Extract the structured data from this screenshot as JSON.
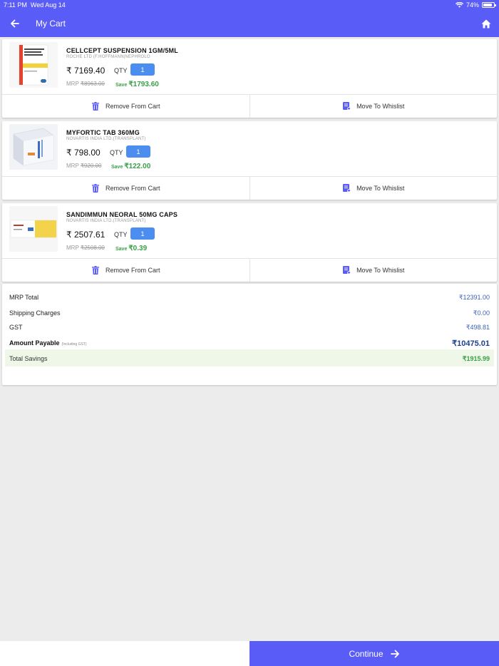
{
  "status_bar": {
    "time": "7:11 PM",
    "date": "Wed Aug 14",
    "battery": "74%"
  },
  "header": {
    "title": "My Cart",
    "back_icon": "arrow-left-icon",
    "home_icon": "home-icon"
  },
  "colors": {
    "primary": "#5a5cf8",
    "qty_button": "#4b8ef0",
    "save_green": "#3aa048",
    "price_blue": "#3b63b8"
  },
  "cart": {
    "qty_label": "QTY",
    "remove_label": "Remove From Cart",
    "wishlist_label": "Move To Whislist",
    "items": [
      {
        "name": "CELLCEPT SUSPENSION 1GM/5ML",
        "manufacturer": "ROCHE LTD (F.HOFFMANN|NEPHROLO",
        "price": "₹ 7169.40",
        "qty": "1",
        "mrp_label": "MRP",
        "mrp": "₹8963.00",
        "save_label": "Save",
        "save": "₹1793.60"
      },
      {
        "name": "MYFORTIC TAB 360MG",
        "manufacturer": "NOVARTIS INDIA LTD.(TRANSPLANT)",
        "price": "₹ 798.00",
        "qty": "1",
        "mrp_label": "MRP",
        "mrp": "₹920.00",
        "save_label": "Save",
        "save": "₹122.00"
      },
      {
        "name": "SANDIMMUN NEORAL 50MG CAPS",
        "manufacturer": "NOVARTIS INDIA LTD.(TRANSPLANT)",
        "price": "₹ 2507.61",
        "qty": "1",
        "mrp_label": "MRP",
        "mrp": "₹2508.00",
        "save_label": "Save",
        "save": "₹0.39"
      }
    ]
  },
  "summary": {
    "mrp_total_label": "MRP Total",
    "mrp_total": "₹12391.00",
    "shipping_label": "Shipping Charges",
    "shipping": "₹0.00",
    "gst_label": "GST",
    "gst": "₹498.81",
    "payable_label": "Amount Payable",
    "payable_note": "(Including GST)",
    "payable": "₹10475.01",
    "savings_label": "Total Savings",
    "savings": "₹1915.99"
  },
  "footer": {
    "continue_label": "Continue"
  }
}
